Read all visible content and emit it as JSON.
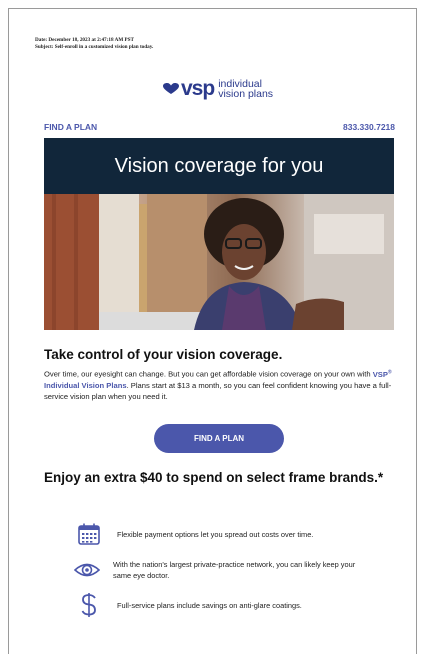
{
  "email_meta": {
    "date": "Date: December 18, 2023 at 2:47:18 AM PST",
    "subject": "Subject: Self-enroll in a customized vision plan today."
  },
  "logo": {
    "brand": "vsp",
    "tagline_line1": "individual",
    "tagline_line2": "vision plans"
  },
  "header": {
    "find_plan_link": "FIND A PLAN",
    "phone": "833.330.7218"
  },
  "banner": {
    "title": "Vision coverage for you"
  },
  "section1": {
    "heading": "Take control of your vision coverage.",
    "body_part1": "Over time, our eyesight can change. But you can get affordable vision coverage on your own with ",
    "link_text": "VSP",
    "link_sup": "®",
    "link_text2": " Individual Vision Plans",
    "body_part2": ". Plans start at $13 a month, so you can feel confident knowing you have a full-service vision plan when you need it."
  },
  "cta": {
    "label": "FIND A PLAN"
  },
  "section2": {
    "heading": "Enjoy an extra $40 to spend on select frame brands.*"
  },
  "benefits": [
    {
      "icon": "calendar-icon",
      "text": "Flexible payment options let you spread out costs over time."
    },
    {
      "icon": "eye-icon",
      "text": "With the nation's largest private-practice network, you can likely keep your same eye doctor."
    },
    {
      "icon": "dollar-icon",
      "text": "Full-service plans include savings on anti-glare coatings."
    }
  ],
  "colors": {
    "brand_blue": "#4b57ab",
    "banner_navy": "#11263a",
    "logo_navy": "#2b3a8c"
  }
}
